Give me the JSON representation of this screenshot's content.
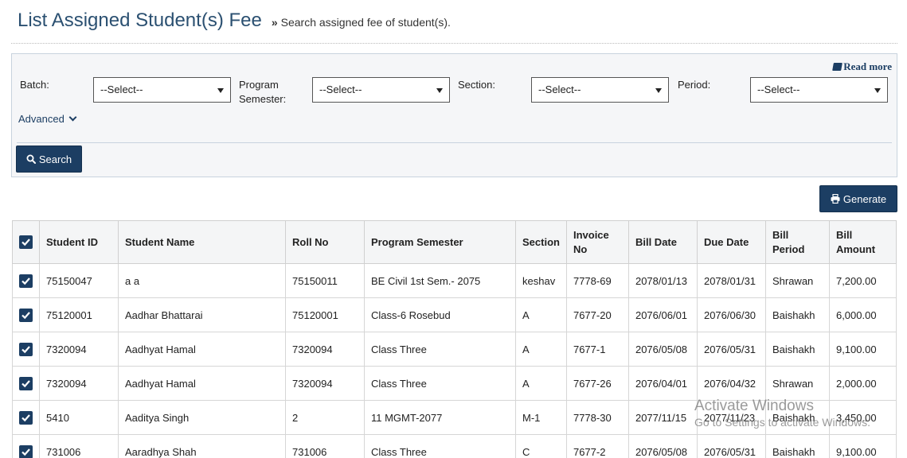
{
  "header": {
    "title": "List Assigned Student(s) Fee",
    "subtitle_marker": "»",
    "subtitle": "Search assigned fee of student(s)."
  },
  "filters": {
    "read_more": "Read more",
    "batch": {
      "label": "Batch:",
      "value": "--Select--"
    },
    "program_semester": {
      "label_line1": "Program",
      "label_line2": "Semester:",
      "value": "--Select--"
    },
    "section": {
      "label": "Section:",
      "value": "--Select--"
    },
    "period": {
      "label": "Period:",
      "value": "--Select--"
    },
    "advanced": "Advanced",
    "search_button": "Search"
  },
  "actions": {
    "generate_button": "Generate"
  },
  "table": {
    "headers": {
      "student_id": "Student ID",
      "student_name": "Student Name",
      "roll_no": "Roll No",
      "program_semester": "Program Semester",
      "section": "Section",
      "invoice_no_1": "Invoice",
      "invoice_no_2": "No",
      "bill_date": "Bill Date",
      "due_date": "Due Date",
      "bill_period": "Bill Period",
      "bill_amount_1": "Bill",
      "bill_amount_2": "Amount"
    },
    "rows": [
      {
        "student_id": "75150047",
        "student_name": "a a",
        "roll_no": "75150011",
        "program_semester": "BE Civil 1st Sem.- 2075",
        "section": "keshav",
        "invoice_no": "7778-69",
        "bill_date": "2078/01/13",
        "due_date": "2078/01/31",
        "bill_period": "Shrawan",
        "bill_amount": "7,200.00"
      },
      {
        "student_id": "75120001",
        "student_name": "Aadhar Bhattarai",
        "roll_no": "75120001",
        "program_semester": "Class-6 Rosebud",
        "section": "A",
        "invoice_no": "7677-20",
        "bill_date": "2076/06/01",
        "due_date": "2076/06/30",
        "bill_period": "Baishakh",
        "bill_amount": "6,000.00"
      },
      {
        "student_id": "7320094",
        "student_name": "Aadhyat Hamal",
        "roll_no": "7320094",
        "program_semester": "Class Three",
        "section": "A",
        "invoice_no": "7677-1",
        "bill_date": "2076/05/08",
        "due_date": "2076/05/31",
        "bill_period": "Baishakh",
        "bill_amount": "9,100.00"
      },
      {
        "student_id": "7320094",
        "student_name": "Aadhyat Hamal",
        "roll_no": "7320094",
        "program_semester": "Class Three",
        "section": "A",
        "invoice_no": "7677-26",
        "bill_date": "2076/04/01",
        "due_date": "2076/04/32",
        "bill_period": "Shrawan",
        "bill_amount": "2,000.00"
      },
      {
        "student_id": "5410",
        "student_name": "Aaditya Singh",
        "roll_no": "2",
        "program_semester": "11 MGMT-2077",
        "section": "M-1",
        "invoice_no": "7778-30",
        "bill_date": "2077/11/15",
        "due_date": "2077/11/23",
        "bill_period": "Baishakh",
        "bill_amount": "3,450.00"
      },
      {
        "student_id": "731006",
        "student_name": "Aaradhya Shah",
        "roll_no": "731006",
        "program_semester": "Class Three",
        "section": "C",
        "invoice_no": "7677-2",
        "bill_date": "2076/05/08",
        "due_date": "2076/05/31",
        "bill_period": "Baishakh",
        "bill_amount": "9,100.00"
      }
    ]
  },
  "watermark": {
    "line1": "Activate Windows",
    "line2": "Go to Settings to activate Windows."
  },
  "colors": {
    "primary": "#1c3e63",
    "title": "#2b5071",
    "header_bg": "#f4f5f6",
    "panel_bg": "#f5f6f8"
  }
}
